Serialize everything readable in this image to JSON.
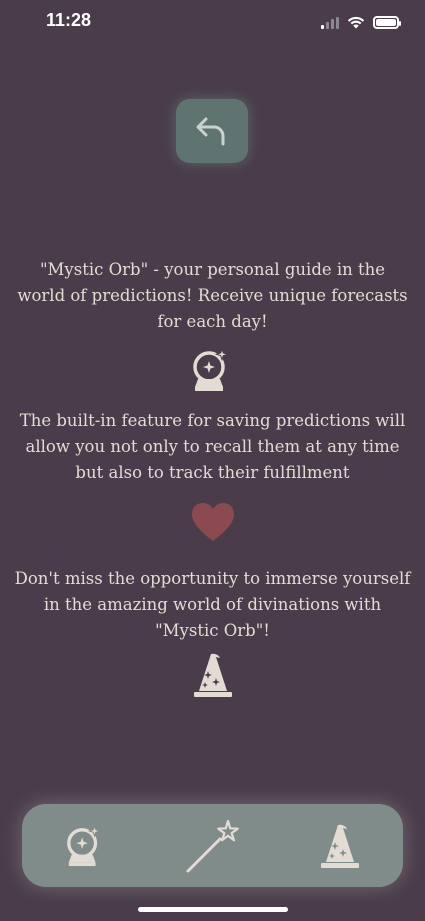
{
  "status_bar": {
    "time": "11:28"
  },
  "back_button": {
    "icon": "back-arrow-icon"
  },
  "sections": [
    {
      "text": "\"Mystic Orb\" - your personal guide in the world of predictions! Receive unique forecasts for each day!",
      "icon": "crystal-ball-icon"
    },
    {
      "text": "The built-in feature for saving predictions will allow you not only to recall them at any time but also to track their fulfillment",
      "icon": "heart-icon"
    },
    {
      "text": "Don't miss the opportunity to immerse yourself in the amazing world of divinations with \"Mystic Orb\"!",
      "icon": "wizard-hat-icon"
    }
  ],
  "tab_bar": {
    "tabs": [
      {
        "icon": "crystal-ball-icon"
      },
      {
        "icon": "magic-wand-icon"
      },
      {
        "icon": "wizard-hat-icon"
      }
    ]
  },
  "colors": {
    "background": "#4a3c4a",
    "back_button": "#5f7470",
    "tab_bar": "#7f8c8a",
    "text": "#e3dcd4",
    "heart": "#8b4a4f"
  }
}
